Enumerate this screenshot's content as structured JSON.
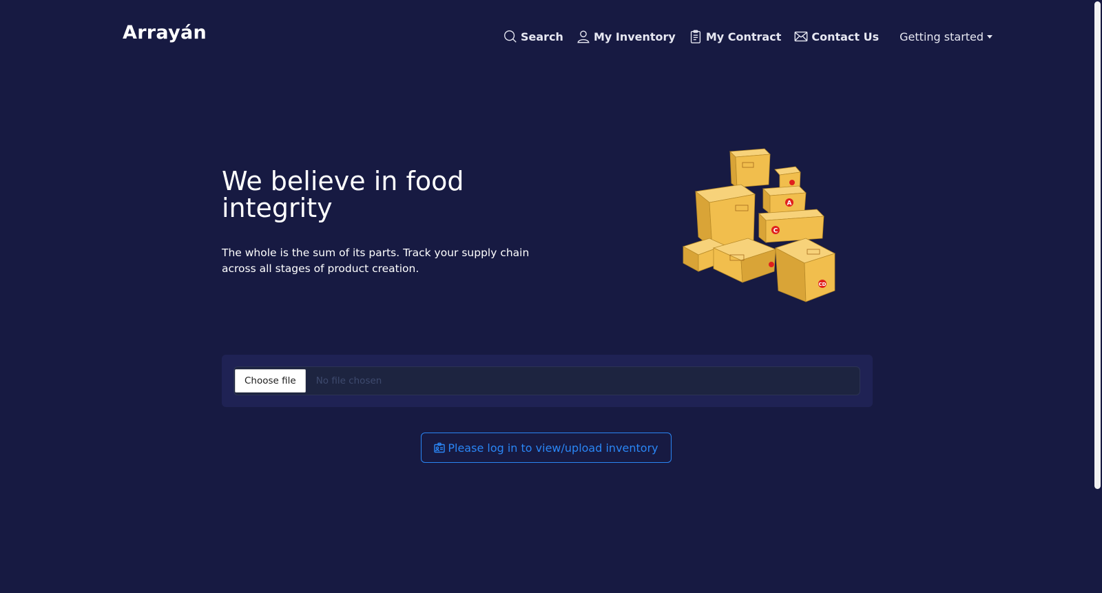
{
  "brand": {
    "name": "Arrayán"
  },
  "nav": {
    "items": [
      {
        "label": "Search",
        "icon": "search-icon"
      },
      {
        "label": "My Inventory",
        "icon": "user-icon"
      },
      {
        "label": "My Contract",
        "icon": "clipboard-icon"
      },
      {
        "label": "Contact Us",
        "icon": "envelope-icon"
      }
    ],
    "dropdown": {
      "label": "Getting started",
      "icon": "caret-down-icon"
    }
  },
  "hero": {
    "title": "We believe in food integrity",
    "text": "The whole is the sum of its parts. Track your supply chain across all stages of product creation.",
    "image": "cardboard-boxes-illustration"
  },
  "upload": {
    "choose_label": "Choose file",
    "status": "No file chosen"
  },
  "login_button": {
    "label": "Please log in to view/upload inventory",
    "icon": "id-badge-icon"
  },
  "colors": {
    "background": "#171a42",
    "card": "#1f2254",
    "input": "#1d2440",
    "accent": "#2a86f5",
    "box": "#f1be4d"
  }
}
